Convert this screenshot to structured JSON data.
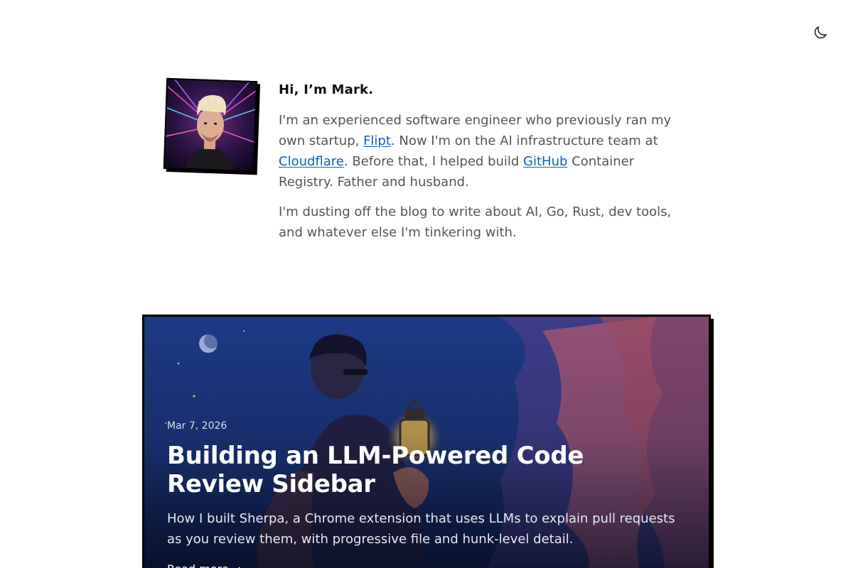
{
  "header": {
    "theme_toggle_icon": "moon-icon"
  },
  "intro": {
    "greeting": "Hi, I’m Mark.",
    "bio": {
      "p1_a": "I'm an experienced software engineer who previously ran my own startup, ",
      "flipt": "Flipt",
      "p1_b": ". Now I'm on the AI infrastructure team at ",
      "cloudflare": "Cloudflare",
      "p1_c": ". Before that, I helped build ",
      "github": "GitHub",
      "p1_d": " Container Registry. Father and husband."
    },
    "p2": "I'm dusting off the blog to write about AI, Go, Rust, dev tools, and whatever else I'm tinkering with."
  },
  "featured_post": {
    "date": "Mar 7, 2026",
    "title": "Building an LLM-Powered Code Review Sidebar",
    "description": "How I built Sherpa, a Chrome extension that uses LLMs to explain pull requests as you review them, with progressive file and hunk-level detail.",
    "read_more": "Read more",
    "read_more_arrow": "→"
  },
  "colors": {
    "link": "#0b61b7",
    "card_bg": "#1c3b85",
    "body_text": "#555555"
  }
}
